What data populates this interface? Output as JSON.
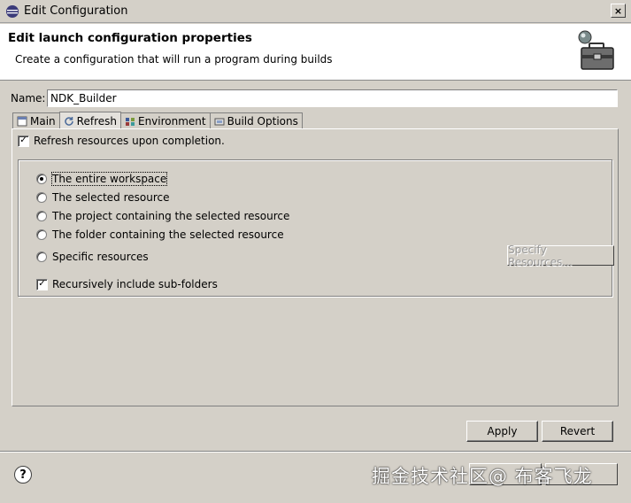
{
  "window": {
    "title": "Edit Configuration",
    "close_glyph": "×"
  },
  "banner": {
    "title": "Edit launch configuration properties",
    "subtitle": "Create a configuration that will run a program during builds",
    "icon": "toolbox-icon"
  },
  "name_field": {
    "label": "Name:",
    "value": "NDK_Builder"
  },
  "tabs": [
    {
      "label": "Main",
      "icon": "main-tab-icon",
      "active": false
    },
    {
      "label": "Refresh",
      "icon": "refresh-tab-icon",
      "active": true
    },
    {
      "label": "Environment",
      "icon": "environment-tab-icon",
      "active": false
    },
    {
      "label": "Build Options",
      "icon": "build-options-tab-icon",
      "active": false
    }
  ],
  "refresh": {
    "refresh_on_completion": {
      "label": "Refresh resources upon completion.",
      "checked": true
    },
    "radios": [
      {
        "label": "The entire workspace",
        "selected": true
      },
      {
        "label": "The selected resource",
        "selected": false
      },
      {
        "label": "The project containing the selected resource",
        "selected": false
      },
      {
        "label": "The folder containing the selected resource",
        "selected": false
      },
      {
        "label": "Specific resources",
        "selected": false
      }
    ],
    "specify_button": "Specify Resources...",
    "recursive": {
      "label": "Recursively include sub-folders",
      "checked": true
    }
  },
  "buttons": {
    "apply": "Apply",
    "revert": "Revert",
    "help_glyph": "?"
  },
  "watermark": "掘金技术社区@ 布客飞龙",
  "colors": {
    "window_bg": "#d4d0c8",
    "banner_bg": "#ffffff",
    "disabled_text": "#9a9a9a"
  }
}
